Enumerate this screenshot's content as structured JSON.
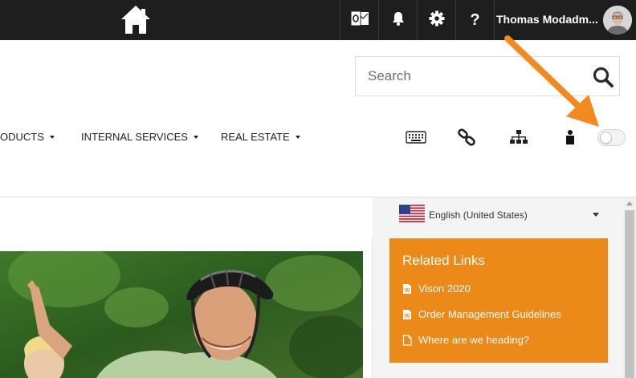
{
  "topbar": {
    "home_icon": "home-icon",
    "outlook_icon": "outlook-icon",
    "bell_icon": "bell-icon",
    "gear_icon": "gear-icon",
    "help_label": "?",
    "user_name": "Thomas Modadm..."
  },
  "search": {
    "placeholder": "Search",
    "icon": "search-icon"
  },
  "nav": {
    "items": [
      {
        "label": "ODUCTS"
      },
      {
        "label": "INTERNAL SERVICES"
      },
      {
        "label": "REAL ESTATE"
      }
    ],
    "icons": [
      "keyboard-icon",
      "link-icon",
      "sitemap-icon",
      "person-icon"
    ],
    "toggle_on": false
  },
  "language": {
    "selected": "English (United States)",
    "flag_icon": "us-flag-icon"
  },
  "related_links": {
    "title": "Related Links",
    "items": [
      {
        "label": "Vison 2020",
        "icon": "word-doc-icon"
      },
      {
        "label": "Order Management Guidelines",
        "icon": "word-doc-icon"
      },
      {
        "label": "Where are we heading?",
        "icon": "page-icon"
      }
    ]
  },
  "colors": {
    "topbar": "#1e1e1e",
    "accent_orange": "#eb8a18",
    "annotation_arrow": "#f28a20"
  }
}
